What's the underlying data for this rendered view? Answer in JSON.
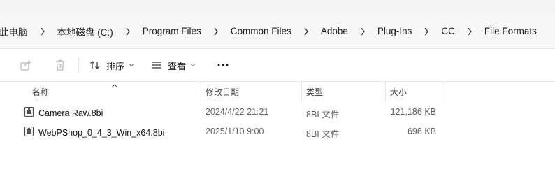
{
  "breadcrumb": [
    "此电脑",
    "本地磁盘 (C:)",
    "Program Files",
    "Common Files",
    "Adobe",
    "Plug-Ins",
    "CC",
    "File Formats"
  ],
  "toolbar": {
    "share_icon": "share-icon",
    "delete_icon": "delete-icon",
    "sort_label": "排序",
    "view_label": "查看",
    "more_icon": "more-icon"
  },
  "columns": {
    "name": "名称",
    "modified": "修改日期",
    "type": "类型",
    "size": "大小"
  },
  "files": [
    {
      "name": "Camera Raw.8bi",
      "modified": "2024/4/22 21:21",
      "type": "8BI 文件",
      "size": "121,186 KB"
    },
    {
      "name": "WebPShop_0_4_3_Win_x64.8bi",
      "modified": "2025/1/10 9:00",
      "type": "8BI 文件",
      "size": "698 KB"
    }
  ],
  "colors": {
    "accent": "#0067c0",
    "toolbar_bg": "#ffffff",
    "addressbar_bg": "#f7f7f7"
  }
}
